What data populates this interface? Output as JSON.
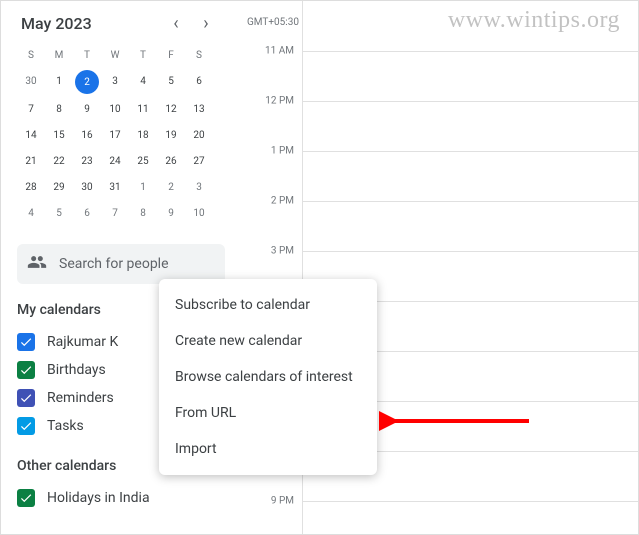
{
  "watermark": "www.wintips.org",
  "timezone": "GMT+05:30",
  "month_title": "May 2023",
  "dow": [
    "S",
    "M",
    "T",
    "W",
    "T",
    "F",
    "S"
  ],
  "weeks": [
    [
      {
        "d": "30",
        "dim": true
      },
      {
        "d": "1"
      },
      {
        "d": "2",
        "sel": true
      },
      {
        "d": "3"
      },
      {
        "d": "4"
      },
      {
        "d": "5"
      },
      {
        "d": "6"
      }
    ],
    [
      {
        "d": "7"
      },
      {
        "d": "8"
      },
      {
        "d": "9"
      },
      {
        "d": "10"
      },
      {
        "d": "11"
      },
      {
        "d": "12"
      },
      {
        "d": "13"
      }
    ],
    [
      {
        "d": "14"
      },
      {
        "d": "15"
      },
      {
        "d": "16"
      },
      {
        "d": "17"
      },
      {
        "d": "18"
      },
      {
        "d": "19"
      },
      {
        "d": "20"
      }
    ],
    [
      {
        "d": "21"
      },
      {
        "d": "22"
      },
      {
        "d": "23"
      },
      {
        "d": "24"
      },
      {
        "d": "25"
      },
      {
        "d": "26"
      },
      {
        "d": "27"
      }
    ],
    [
      {
        "d": "28"
      },
      {
        "d": "29"
      },
      {
        "d": "30"
      },
      {
        "d": "31"
      },
      {
        "d": "1",
        "dim": true
      },
      {
        "d": "2",
        "dim": true
      },
      {
        "d": "3",
        "dim": true
      }
    ],
    [
      {
        "d": "4",
        "dim": true
      },
      {
        "d": "5",
        "dim": true
      },
      {
        "d": "6",
        "dim": true
      },
      {
        "d": "7",
        "dim": true
      },
      {
        "d": "8",
        "dim": true
      },
      {
        "d": "9",
        "dim": true
      },
      {
        "d": "10",
        "dim": true
      }
    ]
  ],
  "search_placeholder": "Search for people",
  "sections": {
    "my_title": "My calendars",
    "other_title": "Other calendars"
  },
  "my_calendars": [
    {
      "label": "Rajkumar K",
      "color": "#1a73e8",
      "checked": true
    },
    {
      "label": "Birthdays",
      "color": "#0b8043",
      "checked": true
    },
    {
      "label": "Reminders",
      "color": "#3f51b5",
      "checked": true
    },
    {
      "label": "Tasks",
      "color": "#039be5",
      "checked": true
    }
  ],
  "other_calendars": [
    {
      "label": "Holidays in India",
      "color": "#0b8043",
      "checked": true
    }
  ],
  "time_labels": [
    "11 AM",
    "12 PM",
    "1 PM",
    "2 PM",
    "3 PM",
    "9 PM"
  ],
  "menu": {
    "items": [
      "Subscribe to calendar",
      "Create new calendar",
      "Browse calendars of interest",
      "From URL",
      "Import"
    ]
  },
  "arrow_color": "#ff0000"
}
